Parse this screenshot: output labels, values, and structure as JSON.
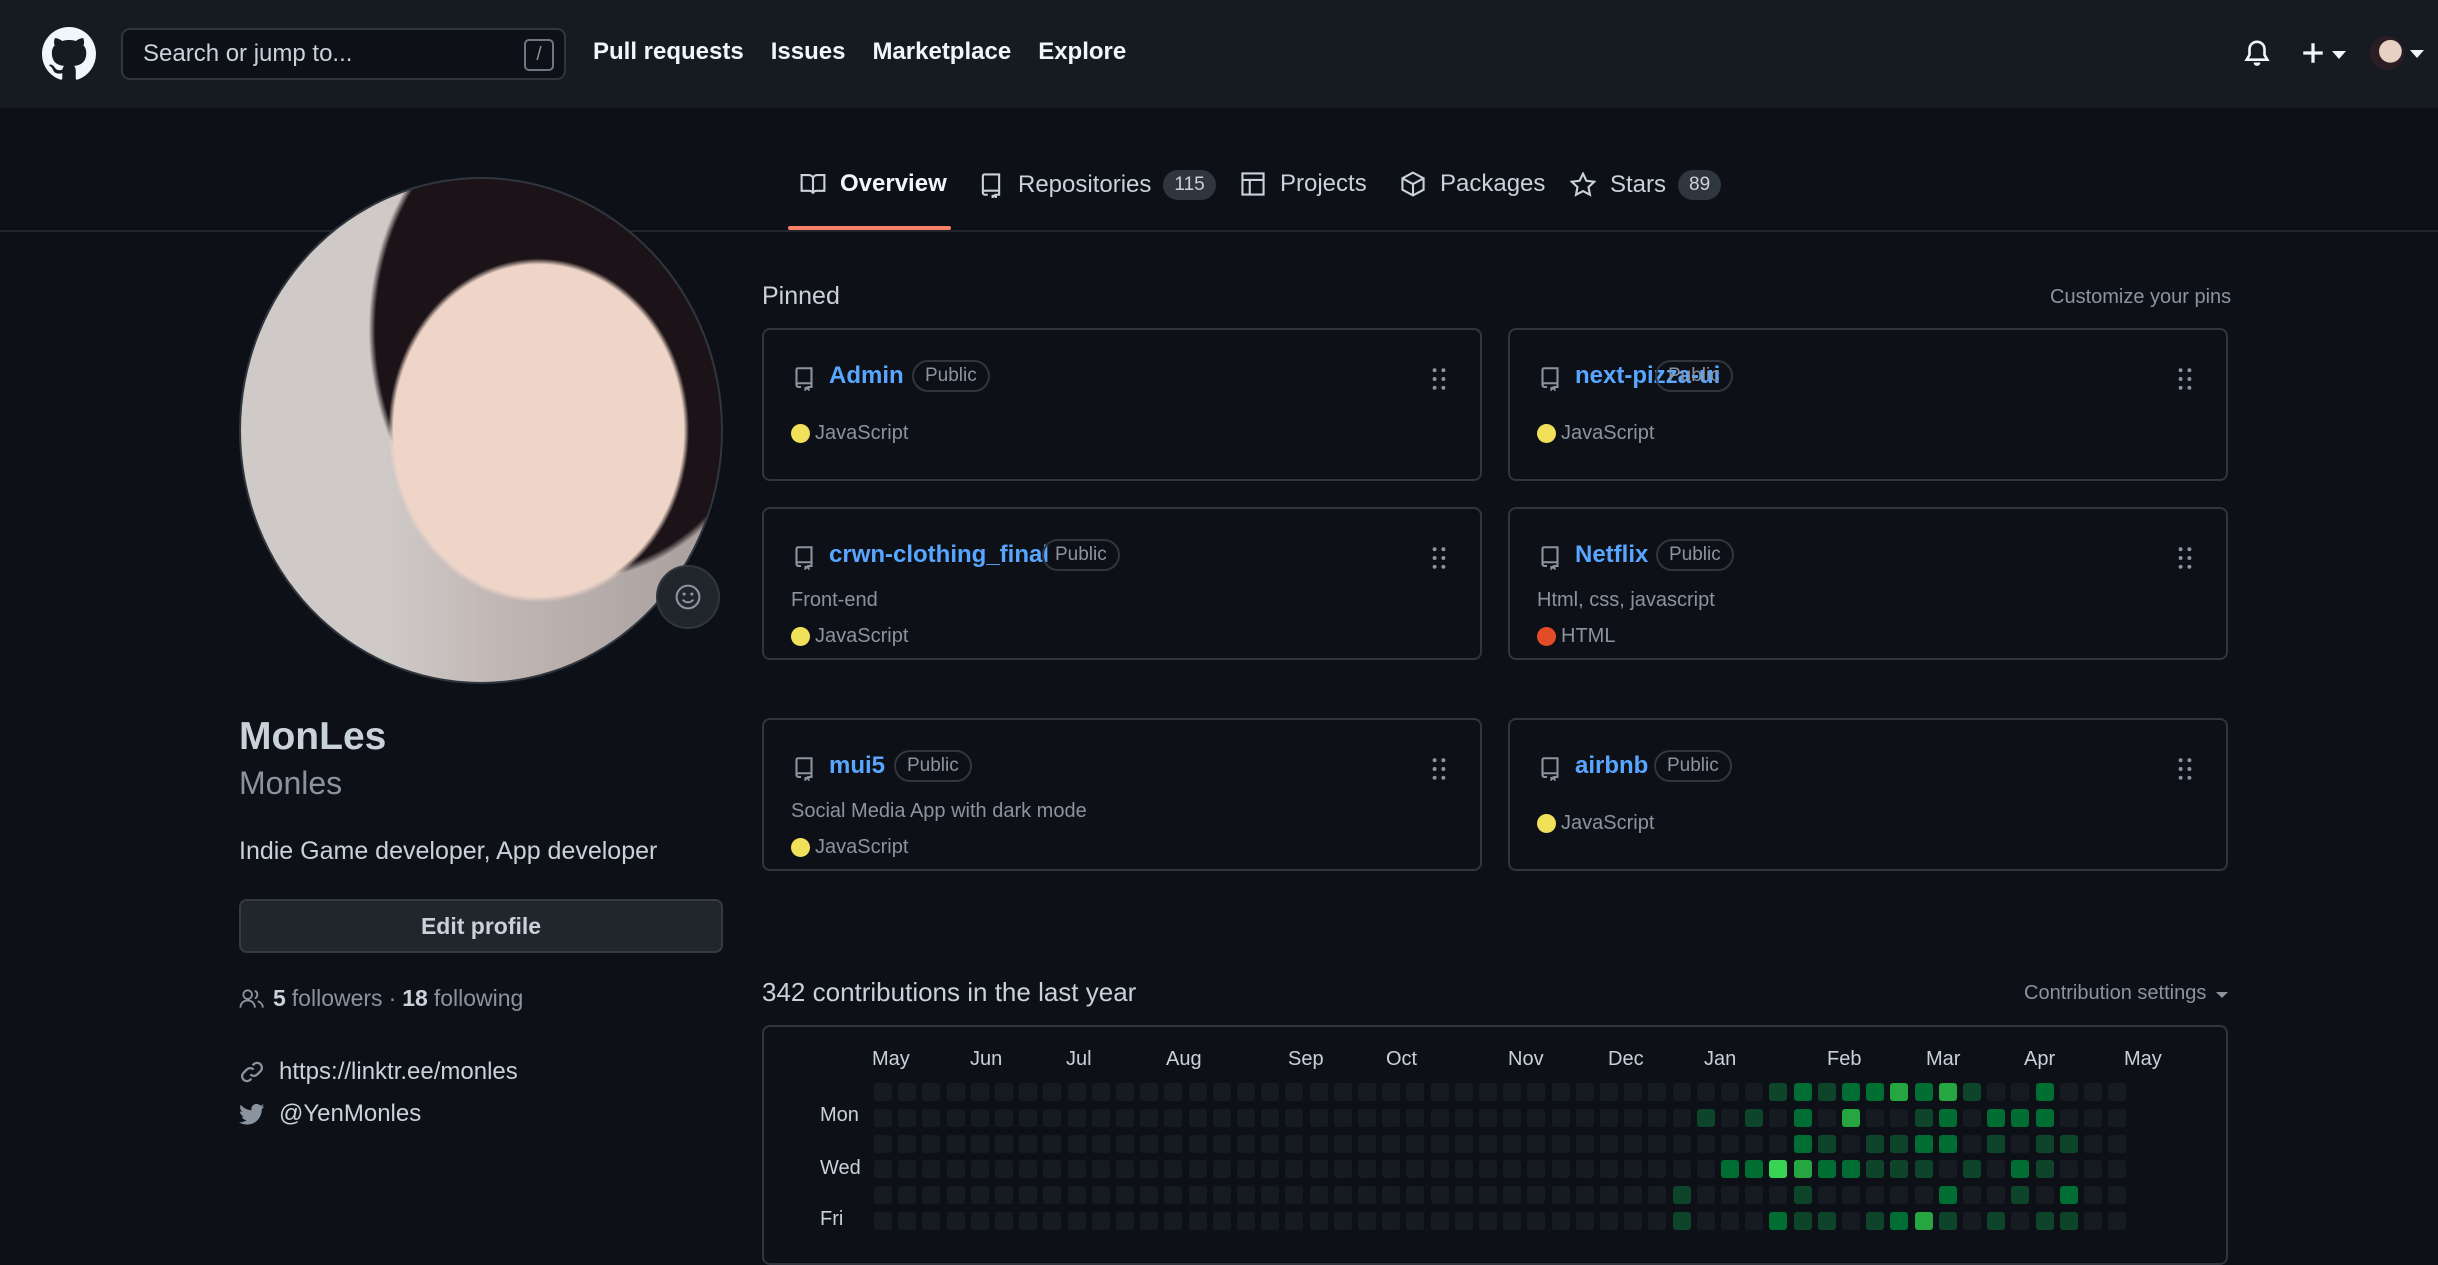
{
  "header": {
    "search_placeholder": "Search or jump to...",
    "search_shortcut": "/",
    "nav": [
      "Pull requests",
      "Issues",
      "Marketplace",
      "Explore"
    ],
    "plus": "+"
  },
  "tabs": [
    {
      "label": "Overview",
      "active": true
    },
    {
      "label": "Repositories",
      "count": "115"
    },
    {
      "label": "Projects"
    },
    {
      "label": "Packages"
    },
    {
      "label": "Stars",
      "count": "89"
    }
  ],
  "profile": {
    "name": "MonLes",
    "username": "Monles",
    "bio": "Indie Game developer, App developer",
    "edit_button": "Edit profile",
    "followers": "5",
    "followers_label": "followers",
    "separator": "·",
    "following": "18",
    "following_label": "following",
    "website": "https://linktr.ee/monles",
    "twitter": "@YenMonles"
  },
  "pinned": {
    "title": "Pinned",
    "customize": "Customize your pins",
    "repos": [
      {
        "name": "Admin",
        "visibility": "Public",
        "description": "",
        "language": "JavaScript",
        "lang_color": "#f1e05a"
      },
      {
        "name": "next-pizza-ui",
        "visibility": "Public",
        "description": "",
        "language": "JavaScript",
        "lang_color": "#f1e05a"
      },
      {
        "name": "crwn-clothing_final",
        "visibility": "Public",
        "description": "Front-end",
        "language": "JavaScript",
        "lang_color": "#f1e05a"
      },
      {
        "name": "Netflix",
        "visibility": "Public",
        "description": "Html, css, javascript",
        "language": "HTML",
        "lang_color": "#e34c26"
      },
      {
        "name": "mui5",
        "visibility": "Public",
        "description": "Social Media App with dark mode",
        "language": "JavaScript",
        "lang_color": "#f1e05a"
      },
      {
        "name": "airbnb",
        "visibility": "Public",
        "description": "",
        "language": "JavaScript",
        "lang_color": "#f1e05a"
      }
    ]
  },
  "contributions": {
    "title": "342 contributions in the last year",
    "settings": "Contribution settings",
    "months": [
      "May",
      "Jun",
      "Jul",
      "Aug",
      "Sep",
      "Oct",
      "Nov",
      "Dec",
      "Jan",
      "Feb",
      "Mar",
      "Apr",
      "May"
    ],
    "days": [
      "Mon",
      "Wed",
      "Fri"
    ],
    "colors": [
      "#161b22",
      "#0e4429",
      "#006d32",
      "#26a641",
      "#39d353"
    ]
  }
}
